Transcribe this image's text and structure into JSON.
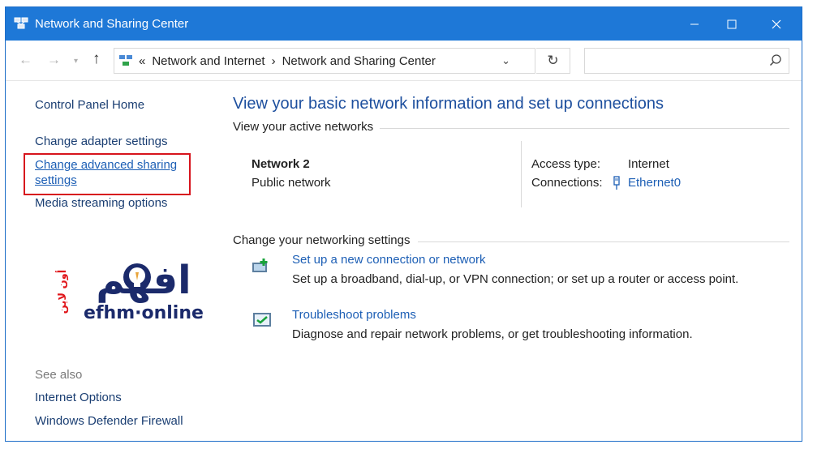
{
  "titlebar": {
    "title": "Network and Sharing Center",
    "icon": "network-center-icon",
    "accent": "#1e78d7"
  },
  "address": {
    "crumb_prefix": "«",
    "crumbs": [
      "Network and Internet",
      "Network and Sharing Center"
    ],
    "separator": "›",
    "search_placeholder": ""
  },
  "sidebar": {
    "home": "Control Panel Home",
    "links": [
      "Change adapter settings",
      "Change advanced sharing",
      "settings",
      "Media streaming options"
    ],
    "see_also_label": "See also",
    "see_also": [
      "Internet Options",
      "Windows Defender Firewall"
    ],
    "highlight_color": "#d7141d"
  },
  "logo": {
    "brand": "efhm·online",
    "arabic": "افهم",
    "arabic_sub": "أون لاين"
  },
  "main": {
    "heading": "View your basic network information and set up connections",
    "active_section": "View your active networks",
    "network_name": "Network 2",
    "network_type": "Public network",
    "access_type_label": "Access type:",
    "access_type_value": "Internet",
    "connections_label": "Connections:",
    "connections_value": "Ethernet0",
    "change_section": "Change your networking settings",
    "tasks": [
      {
        "title": "Set up a new connection or network",
        "desc": "Set up a broadband, dial-up, or VPN connection; or set up a router or access point.",
        "icon": "new-connection-icon"
      },
      {
        "title": "Troubleshoot problems",
        "desc": "Diagnose and repair network problems, or get troubleshooting information.",
        "icon": "troubleshoot-icon"
      }
    ]
  }
}
